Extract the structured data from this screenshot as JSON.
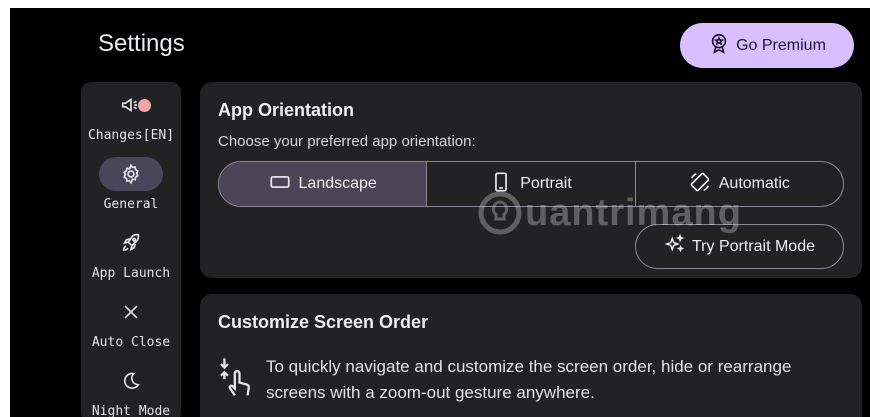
{
  "header": {
    "title": "Settings",
    "premium_label": "Go Premium",
    "premium_icon": "premium-badge-icon"
  },
  "sidebar": {
    "items": [
      {
        "label": "Changes[EN]",
        "icon": "megaphone-icon",
        "active": false,
        "badge": true
      },
      {
        "label": "General",
        "icon": "gear-icon",
        "active": true
      },
      {
        "label": "App Launch",
        "icon": "rocket-icon",
        "active": false
      },
      {
        "label": "Auto Close",
        "icon": "close-icon",
        "active": false
      },
      {
        "label": "Night Mode",
        "icon": "moon-icon",
        "active": false
      }
    ]
  },
  "orientation_card": {
    "title": "App Orientation",
    "subtitle": "Choose your preferred app orientation:",
    "options": [
      {
        "label": "Landscape",
        "icon": "landscape-icon",
        "selected": true
      },
      {
        "label": "Portrait",
        "icon": "phone-portrait-icon",
        "selected": false
      },
      {
        "label": "Automatic",
        "icon": "screen-rotation-icon",
        "selected": false
      }
    ],
    "try_label": "Try Portrait Mode",
    "try_icon": "sparkle-icon"
  },
  "screen_order_card": {
    "title": "Customize Screen Order",
    "description": "To quickly navigate and customize the screen order, hide or rearrange screens with a zoom-out gesture anywhere.",
    "icon": "pinch-gesture-icon"
  },
  "watermark": {
    "text": "uantrimang"
  },
  "colors": {
    "background": "#000000",
    "card": "#222124",
    "accent": "#d9bfff",
    "selected_segment": "#4a4657",
    "active_nav": "#49465a",
    "badge": "#f0a4a8"
  }
}
